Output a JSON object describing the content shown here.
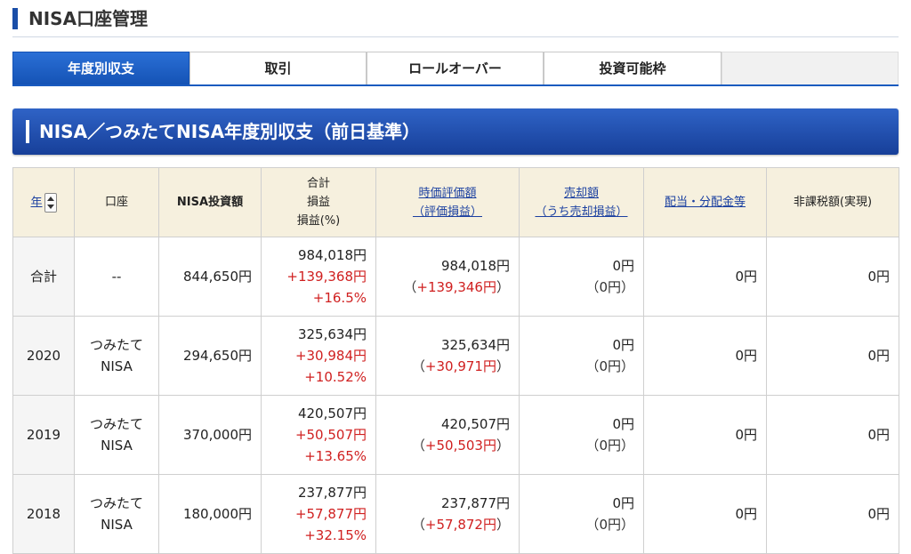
{
  "page": {
    "title": "NISA口座管理"
  },
  "tabs": [
    {
      "label": "年度別収支",
      "active": true
    },
    {
      "label": "取引",
      "active": false
    },
    {
      "label": "ロールオーバー",
      "active": false
    },
    {
      "label": "投資可能枠",
      "active": false
    }
  ],
  "section": {
    "title": "NISA／つみたてNISA年度別収支（前日基準）"
  },
  "table": {
    "headers": {
      "year": "年",
      "account": "口座",
      "investment": "NISA投資額",
      "total_l1": "合計",
      "total_l2": "損益",
      "total_l3": "損益(%)",
      "market_l1": "時価評価額",
      "market_l2": "（評価損益）",
      "sale_l1": "売却額",
      "sale_l2": "（うち売却損益）",
      "dividend": "配当・分配金等",
      "taxfree": "非課税額(実現)"
    },
    "rows": [
      {
        "year": "合計",
        "account_l1": "--",
        "account_l2": "",
        "investment": "844,650円",
        "total": "984,018円",
        "profit": "+139,368円",
        "pct": "+16.5%",
        "market": "984,018円",
        "market_pl": "+139,346円",
        "sale": "0円",
        "sale_pl": "0円",
        "dividend": "0円",
        "taxfree": "0円"
      },
      {
        "year": "2020",
        "account_l1": "つみたて",
        "account_l2": "NISA",
        "investment": "294,650円",
        "total": "325,634円",
        "profit": "+30,984円",
        "pct": "+10.52%",
        "market": "325,634円",
        "market_pl": "+30,971円",
        "sale": "0円",
        "sale_pl": "0円",
        "dividend": "0円",
        "taxfree": "0円"
      },
      {
        "year": "2019",
        "account_l1": "つみたて",
        "account_l2": "NISA",
        "investment": "370,000円",
        "total": "420,507円",
        "profit": "+50,507円",
        "pct": "+13.65%",
        "market": "420,507円",
        "market_pl": "+50,503円",
        "sale": "0円",
        "sale_pl": "0円",
        "dividend": "0円",
        "taxfree": "0円"
      },
      {
        "year": "2018",
        "account_l1": "つみたて",
        "account_l2": "NISA",
        "investment": "180,000円",
        "total": "237,877円",
        "profit": "+57,877円",
        "pct": "+32.15%",
        "market": "237,877円",
        "market_pl": "+57,872円",
        "sale": "0円",
        "sale_pl": "0円",
        "dividend": "0円",
        "taxfree": "0円"
      }
    ]
  },
  "colors": {
    "accent": "#1a5bbf",
    "header_bg": "#f6f0de",
    "positive": "#d02020",
    "link": "#1a3fa0"
  }
}
